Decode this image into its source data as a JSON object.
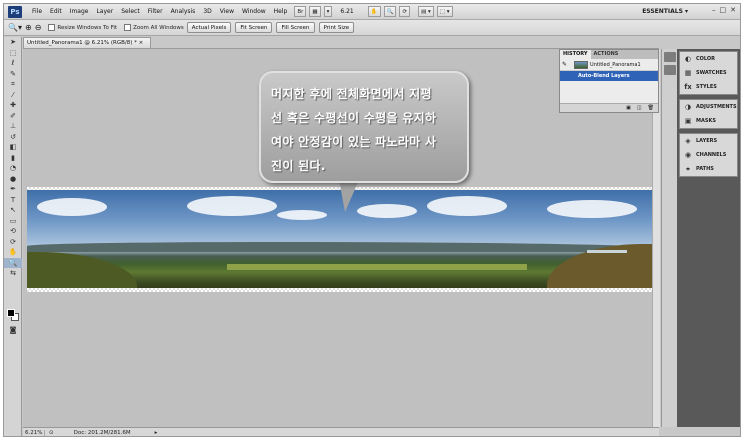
{
  "menubar": {
    "logo": "Ps",
    "items": [
      "File",
      "Edit",
      "Image",
      "Layer",
      "Select",
      "Filter",
      "Analysis",
      "3D",
      "View",
      "Window",
      "Help"
    ],
    "zoom": "6.21",
    "workspace": "ESSENTIALS ▾",
    "window_controls": [
      "–",
      "□",
      "✕"
    ]
  },
  "options": {
    "resize_windows": "Resize Windows To Fit",
    "zoom_all": "Zoom All Windows",
    "buttons": [
      "Actual Pixels",
      "Fit Screen",
      "Fill Screen",
      "Print Size"
    ]
  },
  "document": {
    "tab_title": "Untitled_Panorama1 @ 6.21% (RGB/8) * ×",
    "status_zoom": "6.21%",
    "status_doc": "Doc: 201.2M/281.6M"
  },
  "callout": {
    "lines": [
      "머지한 후에 전체화면에서 지평",
      "선 혹은 수평선이 수평을 유지하",
      "여야 안정감이 있는 파노라마 사",
      "진이 된다."
    ]
  },
  "history": {
    "tabs": [
      "HISTORY",
      "ACTIONS"
    ],
    "snapshot": "Untitled_Panorama1",
    "state": "Auto-Blend Layers"
  },
  "dock": {
    "groups": [
      [
        {
          "icon": "◐",
          "label": "COLOR"
        },
        {
          "icon": "▦",
          "label": "SWATCHES"
        },
        {
          "icon": "fx",
          "label": "STYLES"
        }
      ],
      [
        {
          "icon": "◑",
          "label": "ADJUSTMENTS"
        },
        {
          "icon": "▣",
          "label": "MASKS"
        }
      ],
      [
        {
          "icon": "◈",
          "label": "LAYERS"
        },
        {
          "icon": "◉",
          "label": "CHANNELS"
        },
        {
          "icon": "⌖",
          "label": "PATHS"
        }
      ]
    ]
  }
}
